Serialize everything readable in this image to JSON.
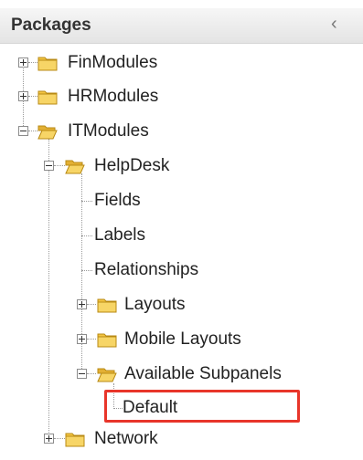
{
  "header": {
    "title": "Packages",
    "collapse_glyph": "‹"
  },
  "tree": {
    "nodes": [
      {
        "label": "FinModules",
        "state": "collapsed",
        "icon": "folder-closed-icon"
      },
      {
        "label": "HRModules",
        "state": "collapsed",
        "icon": "folder-closed-icon"
      },
      {
        "label": "ITModules",
        "state": "expanded",
        "icon": "folder-open-icon"
      },
      {
        "label": "HelpDesk",
        "state": "expanded",
        "icon": "folder-open-icon"
      },
      {
        "label": "Fields",
        "state": "leaf"
      },
      {
        "label": "Labels",
        "state": "leaf"
      },
      {
        "label": "Relationships",
        "state": "leaf"
      },
      {
        "label": "Layouts",
        "state": "collapsed",
        "icon": "folder-closed-icon"
      },
      {
        "label": "Mobile Layouts",
        "state": "collapsed",
        "icon": "folder-closed-icon"
      },
      {
        "label": "Available Subpanels",
        "state": "expanded",
        "icon": "folder-open-icon"
      },
      {
        "label": "Default",
        "state": "leaf",
        "highlighted": true
      },
      {
        "label": "Network",
        "state": "collapsed",
        "icon": "folder-closed-icon"
      }
    ]
  },
  "colors": {
    "highlight_border": "#e8352a",
    "folder_fill": "#f4c542",
    "folder_stroke": "#b88a14"
  }
}
